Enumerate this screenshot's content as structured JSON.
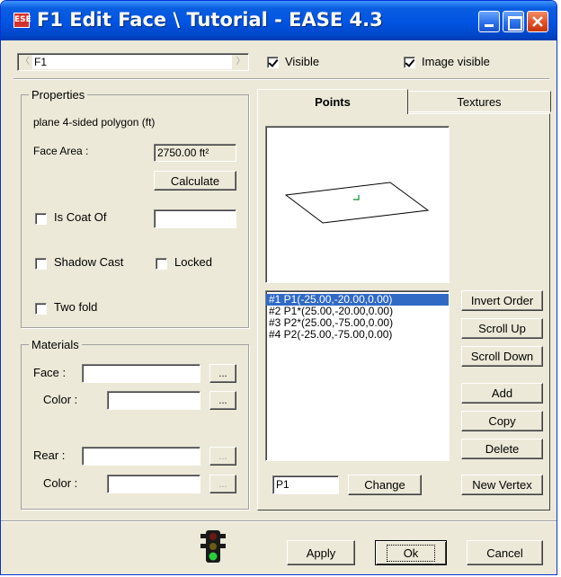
{
  "window": {
    "title": "F1 Edit Face \\ Tutorial - EASE 4.3",
    "app_icon_text": "ESE"
  },
  "top_bar": {
    "face_name": "F1",
    "visible_label": "Visible",
    "visible_checked": true,
    "image_visible_label": "Image visible",
    "image_visible_checked": true
  },
  "properties": {
    "group_label": "Properties",
    "description": "plane  4-sided polygon  (ft)",
    "face_area_label": "Face Area :",
    "face_area_value": "2750.00 ft²",
    "calculate_label": "Calculate",
    "is_coat_of_label": "Is Coat Of",
    "is_coat_of_value": "",
    "shadow_cast_label": "Shadow Cast",
    "locked_label": "Locked",
    "two_fold_label": "Two fold"
  },
  "materials": {
    "group_label": "Materials",
    "face_label": "Face :",
    "face_color_label": "Color :",
    "rear_label": "Rear :",
    "rear_color_label": "Color :",
    "browse_label": "..."
  },
  "tabs": {
    "points_label": "Points",
    "textures_label": "Textures",
    "active": "Points"
  },
  "points": {
    "vertices": [
      "#1  P1(-25.00,-20.00,0.00)",
      "#2  P1*(25.00,-20.00,0.00)",
      "#3  P2*(25.00,-75.00,0.00)",
      "#4  P2(-25.00,-75.00,0.00)"
    ],
    "selected_index": 0,
    "invert_order_label": "Invert Order",
    "scroll_up_label": "Scroll Up",
    "scroll_down_label": "Scroll Down",
    "add_label": "Add",
    "copy_label": "Copy",
    "delete_label": "Delete",
    "point_name_value": "P1",
    "change_label": "Change",
    "new_vertex_label": "New Vertex"
  },
  "footer": {
    "status_icon": "traffic-light-icon",
    "apply_label": "Apply",
    "ok_label": "Ok",
    "cancel_label": "Cancel"
  }
}
